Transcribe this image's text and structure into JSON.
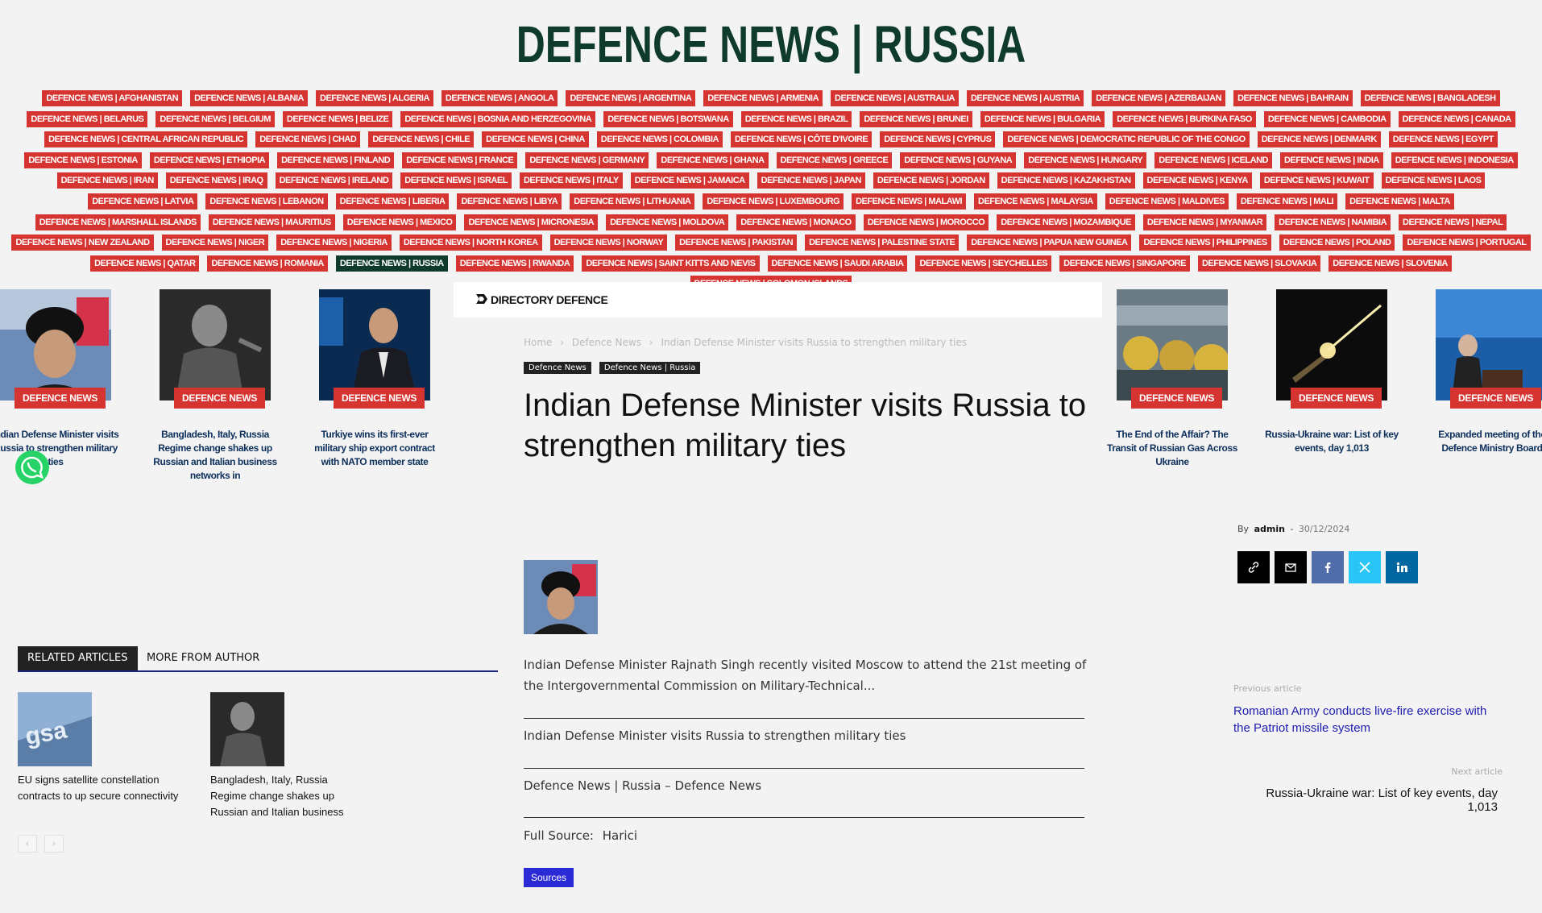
{
  "site": {
    "title": "DEFENCE NEWS | RUSSIA"
  },
  "country_nav": [
    "DEFENCE NEWS | AFGHANISTAN",
    "DEFENCE NEWS | ALBANIA",
    "DEFENCE NEWS | ALGERIA",
    "DEFENCE NEWS | ANGOLA",
    "DEFENCE NEWS | ARGENTINA",
    "DEFENCE NEWS | ARMENIA",
    "DEFENCE NEWS | AUSTRALIA",
    "DEFENCE NEWS | AUSTRIA",
    "DEFENCE NEWS | AZERBAIJAN",
    "DEFENCE NEWS | BAHRAIN",
    "DEFENCE NEWS | BANGLADESH",
    "DEFENCE NEWS | BELARUS",
    "DEFENCE NEWS | BELGIUM",
    "DEFENCE NEWS | BELIZE",
    "DEFENCE NEWS | BOSNIA AND HERZEGOVINA",
    "DEFENCE NEWS | BOTSWANA",
    "DEFENCE NEWS | BRAZIL",
    "DEFENCE NEWS | BRUNEI",
    "DEFENCE NEWS | BULGARIA",
    "DEFENCE NEWS | BURKINA FASO",
    "DEFENCE NEWS | CAMBODIA",
    "DEFENCE NEWS | CANADA",
    "DEFENCE NEWS | CENTRAL AFRICAN REPUBLIC",
    "DEFENCE NEWS | CHAD",
    "DEFENCE NEWS | CHILE",
    "DEFENCE NEWS | CHINA",
    "DEFENCE NEWS | COLOMBIA",
    "DEFENCE NEWS | CÔTE D'IVOIRE",
    "DEFENCE NEWS | CYPRUS",
    "DEFENCE NEWS | DEMOCRATIC REPUBLIC OF THE CONGO",
    "DEFENCE NEWS | DENMARK",
    "DEFENCE NEWS | EGYPT",
    "DEFENCE NEWS | ESTONIA",
    "DEFENCE NEWS | ETHIOPIA",
    "DEFENCE NEWS | FINLAND",
    "DEFENCE NEWS | FRANCE",
    "DEFENCE NEWS | GERMANY",
    "DEFENCE NEWS | GHANA",
    "DEFENCE NEWS | GREECE",
    "DEFENCE NEWS | GUYANA",
    "DEFENCE NEWS | HUNGARY",
    "DEFENCE NEWS | ICELAND",
    "DEFENCE NEWS | INDIA",
    "DEFENCE NEWS | INDONESIA",
    "DEFENCE NEWS | IRAN",
    "DEFENCE NEWS | IRAQ",
    "DEFENCE NEWS | IRELAND",
    "DEFENCE NEWS | ISRAEL",
    "DEFENCE NEWS | ITALY",
    "DEFENCE NEWS | JAMAICA",
    "DEFENCE NEWS | JAPAN",
    "DEFENCE NEWS | JORDAN",
    "DEFENCE NEWS | KAZAKHSTAN",
    "DEFENCE NEWS | KENYA",
    "DEFENCE NEWS | KUWAIT",
    "DEFENCE NEWS | LAOS",
    "DEFENCE NEWS | LATVIA",
    "DEFENCE NEWS | LEBANON",
    "DEFENCE NEWS | LIBERIA",
    "DEFENCE NEWS | LIBYA",
    "DEFENCE NEWS | LITHUANIA",
    "DEFENCE NEWS | LUXEMBOURG",
    "DEFENCE NEWS | MALAWI",
    "DEFENCE NEWS | MALAYSIA",
    "DEFENCE NEWS | MALDIVES",
    "DEFENCE NEWS | MALI",
    "DEFENCE NEWS | MALTA",
    "DEFENCE NEWS | MARSHALL ISLANDS",
    "DEFENCE NEWS | MAURITIUS",
    "DEFENCE NEWS | MEXICO",
    "DEFENCE NEWS | MICRONESIA",
    "DEFENCE NEWS | MOLDOVA",
    "DEFENCE NEWS | MONACO",
    "DEFENCE NEWS | MOROCCO",
    "DEFENCE NEWS | MOZAMBIQUE",
    "DEFENCE NEWS | MYANMAR",
    "DEFENCE NEWS | NAMIBIA",
    "DEFENCE NEWS | NEPAL",
    "DEFENCE NEWS | NEW ZEALAND",
    "DEFENCE NEWS | NIGER",
    "DEFENCE NEWS | NIGERIA",
    "DEFENCE NEWS | NORTH KOREA",
    "DEFENCE NEWS | NORWAY",
    "DEFENCE NEWS | PAKISTAN",
    "DEFENCE NEWS | PALESTINE STATE",
    "DEFENCE NEWS | PAPUA NEW GUINEA",
    "DEFENCE NEWS | PHILIPPINES",
    "DEFENCE NEWS | POLAND",
    "DEFENCE NEWS | PORTUGAL",
    "DEFENCE NEWS | QATAR",
    "DEFENCE NEWS | ROMANIA",
    "DEFENCE NEWS | RUSSIA",
    "DEFENCE NEWS | RWANDA",
    "DEFENCE NEWS | SAINT KITTS AND NEVIS",
    "DEFENCE NEWS | SAUDI ARABIA",
    "DEFENCE NEWS | SEYCHELLES",
    "DEFENCE NEWS | SINGAPORE",
    "DEFENCE NEWS | SLOVAKIA",
    "DEFENCE NEWS | SLOVENIA",
    "DEFENCE NEWS | SOLOMON ISLANDS"
  ],
  "active_country": "DEFENCE NEWS | RUSSIA",
  "carousel_left": [
    {
      "badge": "DEFENCE NEWS",
      "caption": "Indian Defense Minister visits Russia to strengthen military ties"
    },
    {
      "badge": "DEFENCE NEWS",
      "caption": "Bangladesh, Italy, Russia Regime change shakes up Russian and Italian business networks in"
    },
    {
      "badge": "DEFENCE NEWS",
      "caption": "Turkiye wins its first-ever military ship export contract with NATO member state"
    }
  ],
  "carousel_right": [
    {
      "badge": "DEFENCE NEWS",
      "caption": "The End of the Affair? The Transit of Russian Gas Across Ukraine"
    },
    {
      "badge": "DEFENCE NEWS",
      "caption": "Russia-Ukraine war: List of key events, day 1,013"
    },
    {
      "badge": "DEFENCE NEWS",
      "caption": "Expanded meeting of the Defence Ministry Board"
    }
  ],
  "directory": {
    "label": "DIRECTORY DEFENCE"
  },
  "breadcrumb": {
    "home": "Home",
    "sep": "›",
    "section": "Defence News",
    "current": "Indian Defense Minister visits Russia to strengthen military ties"
  },
  "tags": [
    "Defence News",
    "Defence News | Russia"
  ],
  "article": {
    "title": "Indian Defense Minister visits Russia to strengthen military ties",
    "excerpt": "Indian Defense Minister Rajnath Singh recently visited Moscow to attend the 21st meeting of the Intergovernmental Commission on Military-Technical...",
    "link_title": "Indian Defense Minister visits Russia to strengthen military ties",
    "link_source": "Defence News | Russia – Defence News",
    "full_source_label": "Full Source:",
    "full_source_value": "Harici",
    "sources_button": "Sources"
  },
  "meta": {
    "by": "By",
    "author": "admin",
    "dash": "-",
    "date": "30/12/2024"
  },
  "share": {
    "colors": {
      "link": "#000000",
      "mail": "#000000",
      "facebook": "#516eab",
      "x": "#29c5f6",
      "linkedin": "#0266a0"
    }
  },
  "related": {
    "tab_active": "RELATED ARTICLES",
    "tab_other": "MORE FROM AUTHOR",
    "items": [
      {
        "caption": "EU signs satellite constellation contracts to up secure connectivity"
      },
      {
        "caption": "Bangladesh, Italy, Russia Regime change shakes up Russian and Italian business networks in Dacca"
      }
    ],
    "prev": "‹",
    "next": "›"
  },
  "post_nav": {
    "prev_label": "Previous article",
    "prev_title": "Romanian Army conducts live-fire exercise with the Patriot missile system",
    "next_label": "Next article",
    "next_title": "Russia-Ukraine war: List of key events, day 1,013"
  },
  "colors": {
    "nav_red": "#d63431",
    "nav_active": "#0e3b2e",
    "title_green": "#0e3b2e",
    "link_blue": "#1c1cb0",
    "sources_blue": "#2b2bd6"
  }
}
